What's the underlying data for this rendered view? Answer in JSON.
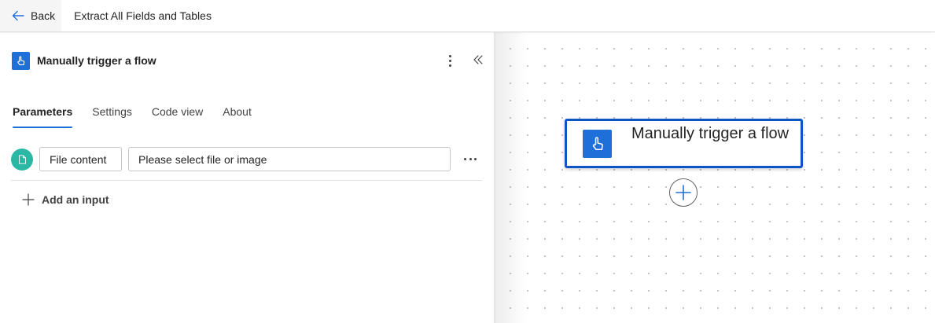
{
  "topbar": {
    "back_label": "Back",
    "flow_title": "Extract All Fields and Tables"
  },
  "panel": {
    "title": "Manually trigger a flow",
    "tabs": [
      {
        "label": "Parameters",
        "active": true
      },
      {
        "label": "Settings",
        "active": false
      },
      {
        "label": "Code view",
        "active": false
      },
      {
        "label": "About",
        "active": false
      }
    ],
    "input_row": {
      "icon": "file-icon",
      "field_name": "File content",
      "field_placeholder": "Please select file or image"
    },
    "add_input_label": "Add an input"
  },
  "canvas": {
    "node_title": "Manually trigger a flow",
    "node_icon": "hand-pointer-icon",
    "add_step_icon": "plus-icon"
  },
  "colors": {
    "accent": "#1f6fd8",
    "node_border": "#0f54c4",
    "file_badge": "#2ab7a3"
  }
}
